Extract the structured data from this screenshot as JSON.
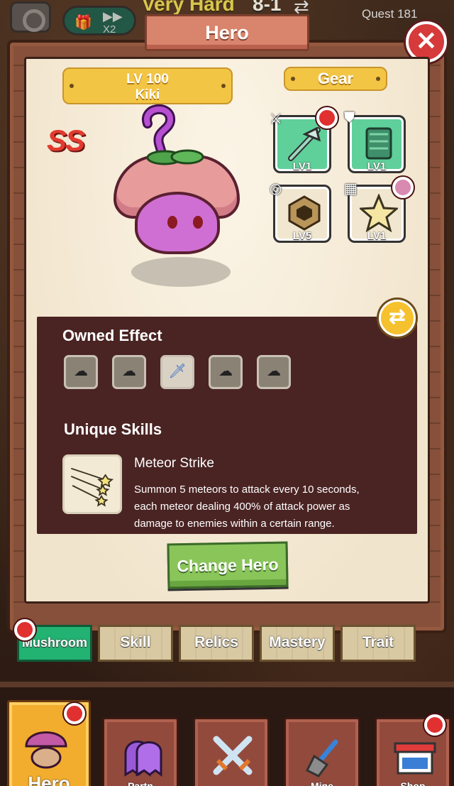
{
  "top_bar": {
    "speed_multiplier": "X2",
    "difficulty": "Very Hard",
    "stage": "8-1",
    "quest": "Quest 181"
  },
  "window": {
    "title": "Hero",
    "close_label": "✕"
  },
  "hero": {
    "level": "LV 100",
    "name": "Kiki",
    "rank": "SS"
  },
  "gear": {
    "header": "Gear",
    "slots": [
      {
        "type": "weapon",
        "level": "LV1",
        "has_alert": true
      },
      {
        "type": "armor",
        "level": "LV1",
        "has_alert": false
      },
      {
        "type": "ring",
        "level": "LV5",
        "has_alert": false
      },
      {
        "type": "relic",
        "level": "LV1",
        "has_alert": false
      }
    ]
  },
  "owned_effect": {
    "title": "Owned Effect",
    "slots": [
      "lightning-cloud",
      "lightning-cloud",
      "sword",
      "lightning-cloud",
      "lightning-cloud"
    ]
  },
  "unique_skills": {
    "title": "Unique Skills",
    "skill_name": "Meteor Strike",
    "description": "Summon 5 meteors to attack every 10 seconds, each meteor dealing 400% of attack power as damage to enemies within a certain range."
  },
  "change_hero_label": "Change Hero",
  "sub_tabs": [
    {
      "label": "Mushroom",
      "active": true
    },
    {
      "label": "Skill",
      "active": false
    },
    {
      "label": "Relics",
      "active": false
    },
    {
      "label": "Mastery",
      "active": false
    },
    {
      "label": "Trait",
      "active": false
    }
  ],
  "bottom_nav": [
    {
      "label": "Hero",
      "active": true
    },
    {
      "label": "Partn",
      "active": false
    },
    {
      "label": "",
      "active": false
    },
    {
      "label": "Mine",
      "active": false
    },
    {
      "label": "Shop",
      "active": false
    }
  ],
  "colors": {
    "active_tab": "#22b271",
    "alert_dot": "#e03030",
    "ribbon": "#f3c544",
    "panel": "#4a2323",
    "change_button": "#8ac55a"
  }
}
